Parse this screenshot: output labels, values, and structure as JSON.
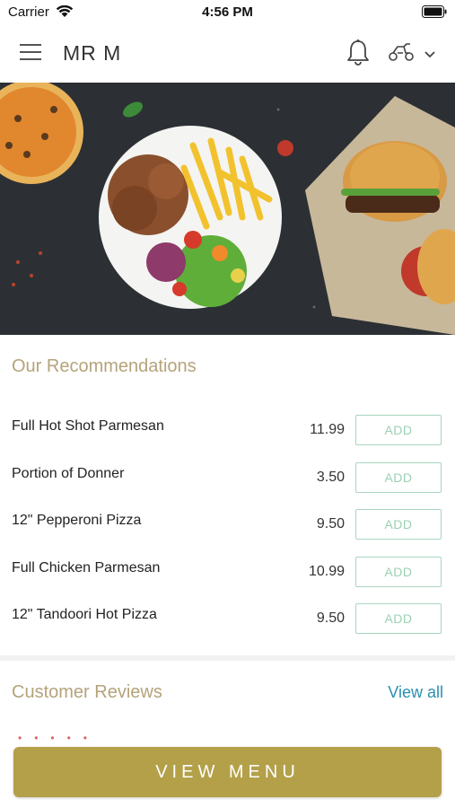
{
  "status_bar": {
    "carrier": "Carrier",
    "time": "4:56 PM"
  },
  "header": {
    "title": "MR M"
  },
  "recommendations": {
    "title": "Our Recommendations",
    "items": [
      {
        "name": "Full Hot Shot Parmesan",
        "price": "11.99",
        "add_label": "ADD"
      },
      {
        "name": "Portion of Donner",
        "price": "3.50",
        "add_label": "ADD"
      },
      {
        "name": "12\" Pepperoni Pizza",
        "price": "9.50",
        "add_label": "ADD"
      },
      {
        "name": "Full Chicken Parmesan",
        "price": "10.99",
        "add_label": "ADD"
      },
      {
        "name": "12\" Tandoori Hot Pizza",
        "price": "9.50",
        "add_label": "ADD"
      }
    ]
  },
  "reviews": {
    "title": "Customer Reviews",
    "view_all_label": "View all"
  },
  "footer": {
    "view_menu_label": "VIEW MENU"
  },
  "colors": {
    "accent_gold": "#b3a049",
    "section_title": "#b5a37a",
    "add_border": "#a9d6be",
    "link": "#2a8fb0"
  },
  "icons": [
    "menu-icon",
    "bell-icon",
    "scooter-icon",
    "chevron-down-icon",
    "wifi-icon",
    "battery-icon"
  ]
}
